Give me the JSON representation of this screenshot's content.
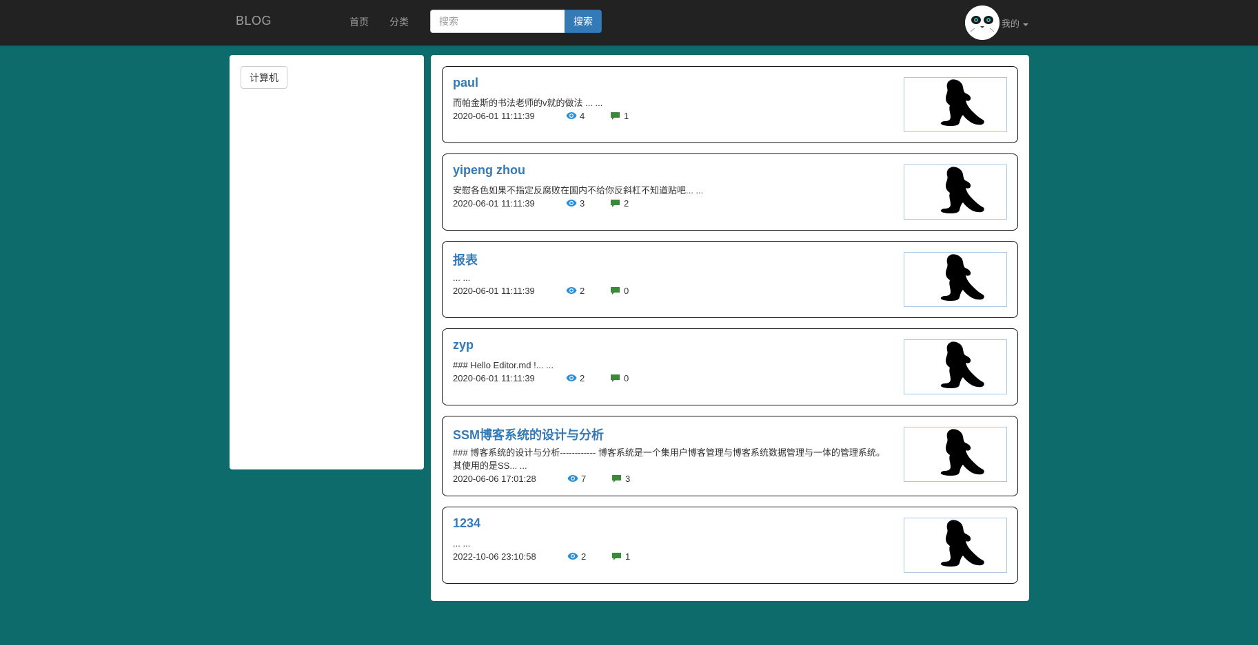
{
  "navbar": {
    "brand": "BLOG",
    "links": [
      {
        "label": "首页"
      },
      {
        "label": "分类"
      }
    ],
    "search_placeholder": "搜索",
    "search_button": "搜索",
    "user_menu_label": "我的"
  },
  "sidebar": {
    "categories": [
      {
        "label": "计算机"
      }
    ]
  },
  "posts": [
    {
      "title": "paul",
      "excerpt": "而帕金斯的书法老师的v就的做法 ... ...",
      "date": "2020-06-01 11:11:39",
      "views": "4",
      "comments": "1"
    },
    {
      "title": "yipeng zhou",
      "excerpt": "安慰各色如果不指定反腐败在国内不给你反斜杠不知道贴吧... ...",
      "date": "2020-06-01 11:11:39",
      "views": "3",
      "comments": "2"
    },
    {
      "title": "报表",
      "excerpt": "... ...",
      "date": "2020-06-01 11:11:39",
      "views": "2",
      "comments": "0"
    },
    {
      "title": "zyp",
      "excerpt": "### Hello Editor.md !... ...",
      "date": "2020-06-01 11:11:39",
      "views": "2",
      "comments": "0"
    },
    {
      "title": "SSM博客系统的设计与分析",
      "excerpt": "### 博客系统的设计与分析------------ 博客系统是一个集用户博客管理与博客系统数据管理与一体的管理系统。 其使用的是SS... ...",
      "date": "2020-06-06 17:01:28",
      "views": "7",
      "comments": "3"
    },
    {
      "title": "1234",
      "excerpt": "... ...",
      "date": "2022-10-06 23:10:58",
      "views": "2",
      "comments": "1"
    }
  ],
  "colors": {
    "background": "#0e6b6b",
    "navbar": "#222222",
    "link": "#337ab7",
    "eye_icon": "#2b8fd6",
    "comment_icon": "#3a8a3a"
  },
  "icons": {
    "views": "eye-icon",
    "comments": "comment-icon",
    "user": "avatar",
    "dropdown": "caret-down-icon"
  }
}
